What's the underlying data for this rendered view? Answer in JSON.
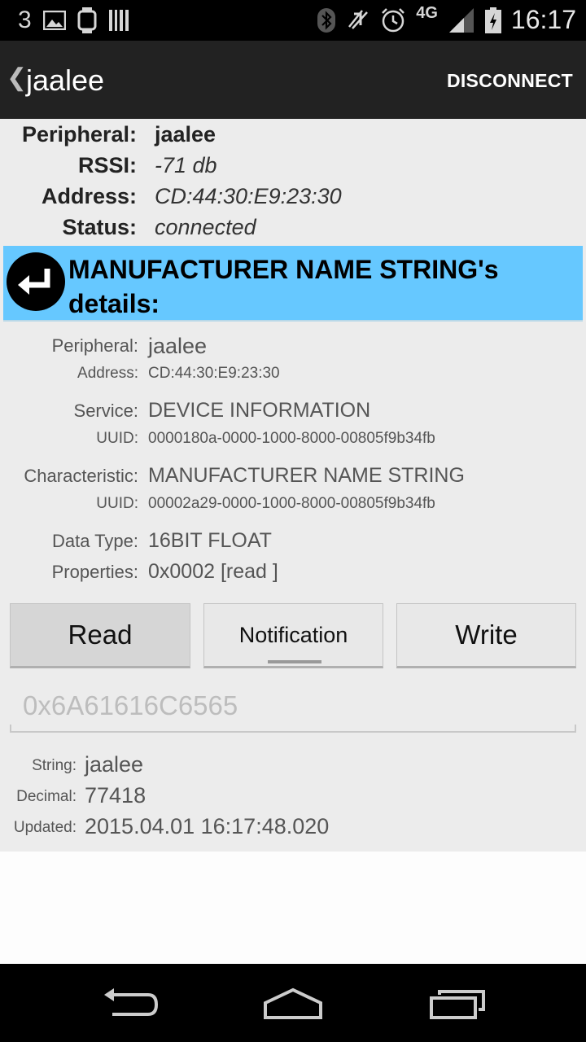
{
  "status_bar": {
    "notification_count": "3",
    "time": "16:17",
    "network": "4G"
  },
  "action_bar": {
    "title": "jaalee",
    "disconnect_label": "DISCONNECT"
  },
  "peripheral_info": {
    "peripheral_label": "Peripheral:",
    "peripheral_value": "jaalee",
    "rssi_label": "RSSI:",
    "rssi_value": "-71 db",
    "address_label": "Address:",
    "address_value": "CD:44:30:E9:23:30",
    "status_label": "Status:",
    "status_value": "connected"
  },
  "banner": {
    "title": "MANUFACTURER NAME STRING's details:"
  },
  "details": {
    "peripheral_label": "Peripheral:",
    "peripheral_value": "jaalee",
    "address_label": "Address:",
    "address_value": "CD:44:30:E9:23:30",
    "service_label": "Service:",
    "service_value": "DEVICE INFORMATION",
    "service_uuid_label": "UUID:",
    "service_uuid_value": "0000180a-0000-1000-8000-00805f9b34fb",
    "characteristic_label": "Characteristic:",
    "characteristic_value": "MANUFACTURER NAME STRING",
    "char_uuid_label": "UUID:",
    "char_uuid_value": "00002a29-0000-1000-8000-00805f9b34fb",
    "datatype_label": "Data Type:",
    "datatype_value": "16BIT FLOAT",
    "properties_label": "Properties:",
    "properties_value": "0x0002 [read ]"
  },
  "buttons": {
    "read_label": "Read",
    "notification_label": "Notification",
    "write_label": "Write"
  },
  "value_field": {
    "placeholder": "0x6A61616C6565"
  },
  "result": {
    "string_label": "String:",
    "string_value": "jaalee",
    "decimal_label": "Decimal:",
    "decimal_value": "77418",
    "updated_label": "Updated:",
    "updated_value": "2015.04.01 16:17:48.020"
  },
  "icons": {
    "banner_back": "return-arrow-icon",
    "nav_back": "back-icon",
    "nav_home": "home-icon",
    "nav_recents": "recents-icon"
  },
  "colors": {
    "banner": "#66c8ff",
    "action_bar": "#222222",
    "content_bg": "#ececec"
  }
}
